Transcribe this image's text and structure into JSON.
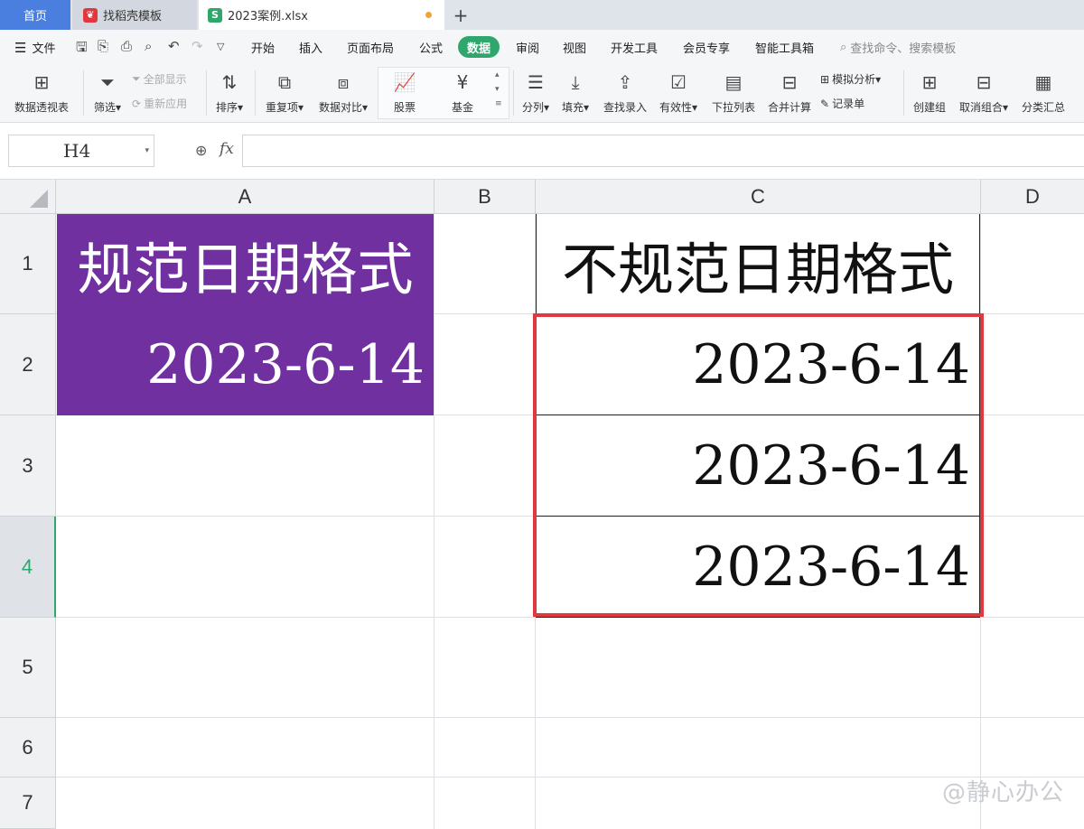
{
  "tabs": {
    "home": "首页",
    "template": "找稻壳模板",
    "file": "2023案例.xlsx",
    "new_tab": "+"
  },
  "menu": {
    "file_label": "文件",
    "items": [
      "开始",
      "插入",
      "页面布局",
      "公式",
      "数据",
      "审阅",
      "视图",
      "开发工具",
      "会员专享",
      "智能工具箱"
    ],
    "active": "数据",
    "search_placeholder": "查找命令、搜索模板"
  },
  "ribbon": {
    "pivot": "数据透视表",
    "filter": "筛选",
    "show_all": "全部显示",
    "reapply": "重新应用",
    "sort": "排序",
    "duplicates": "重复项",
    "compare": "数据对比",
    "stocks": "股票",
    "funds": "基金",
    "split": "分列",
    "fill": "填充",
    "lookup": "查找录入",
    "validation": "有效性",
    "dropdown": "下拉列表",
    "consolidate": "合并计算",
    "whatif": "模拟分析",
    "form": "记录单",
    "group": "创建组",
    "ungroup": "取消组合",
    "subtotal": "分类汇总"
  },
  "formula_bar": {
    "name_box": "H4",
    "fx": "fx",
    "value": ""
  },
  "sheet": {
    "columns": [
      "A",
      "B",
      "C",
      "D"
    ],
    "rows": [
      "1",
      "2",
      "3",
      "4",
      "5",
      "6",
      "7"
    ],
    "active_row": "4",
    "cells": {
      "A1": "规范日期格式",
      "A2": "2023-6-14",
      "C1": "不规范日期格式",
      "C2": "2023-6-14",
      "C3": "2023-6-14",
      "C4": "2023-6-14"
    },
    "accent_colors": {
      "purple_fill": "#7030a0",
      "highlight_border": "#e0383e",
      "active_tab": "#2fa66b"
    }
  },
  "watermark": "@静心办公"
}
